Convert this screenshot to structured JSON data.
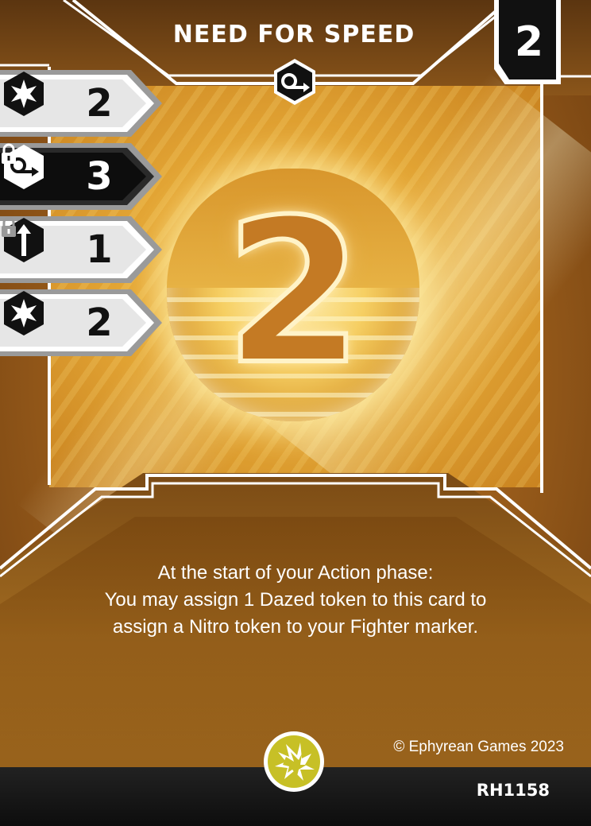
{
  "card": {
    "title": "NEED FOR SPEED",
    "cost": "2",
    "center_number": "2",
    "type_icon": "speed-arrow-hexagon-icon",
    "rules_text": [
      "At the start of your Action phase:",
      "You may assign 1 Dazed token to this card to",
      "assign a Nitro token to your Fighter marker."
    ],
    "copyright": "© Ephyrean Games 2023",
    "card_code": "RH1158",
    "faction_logo": "lightning-burst-icon"
  },
  "stats": [
    {
      "icon": "burst-star-hexagon-icon",
      "value": "2",
      "style": "light",
      "locked": false
    },
    {
      "icon": "speed-arrow-hexagon-icon",
      "value": "3",
      "style": "dark",
      "locked": true
    },
    {
      "icon": "up-arrow-hexagon-icon",
      "value": "1",
      "style": "light",
      "locked": true
    },
    {
      "icon": "burst-star-hexagon-icon",
      "value": "2",
      "style": "light",
      "locked": false
    }
  ],
  "colors": {
    "accent_gold": "#e6a937",
    "panel_brown": "#8a551a",
    "frame_white": "#ffffff",
    "tab_dark": "#111111"
  }
}
